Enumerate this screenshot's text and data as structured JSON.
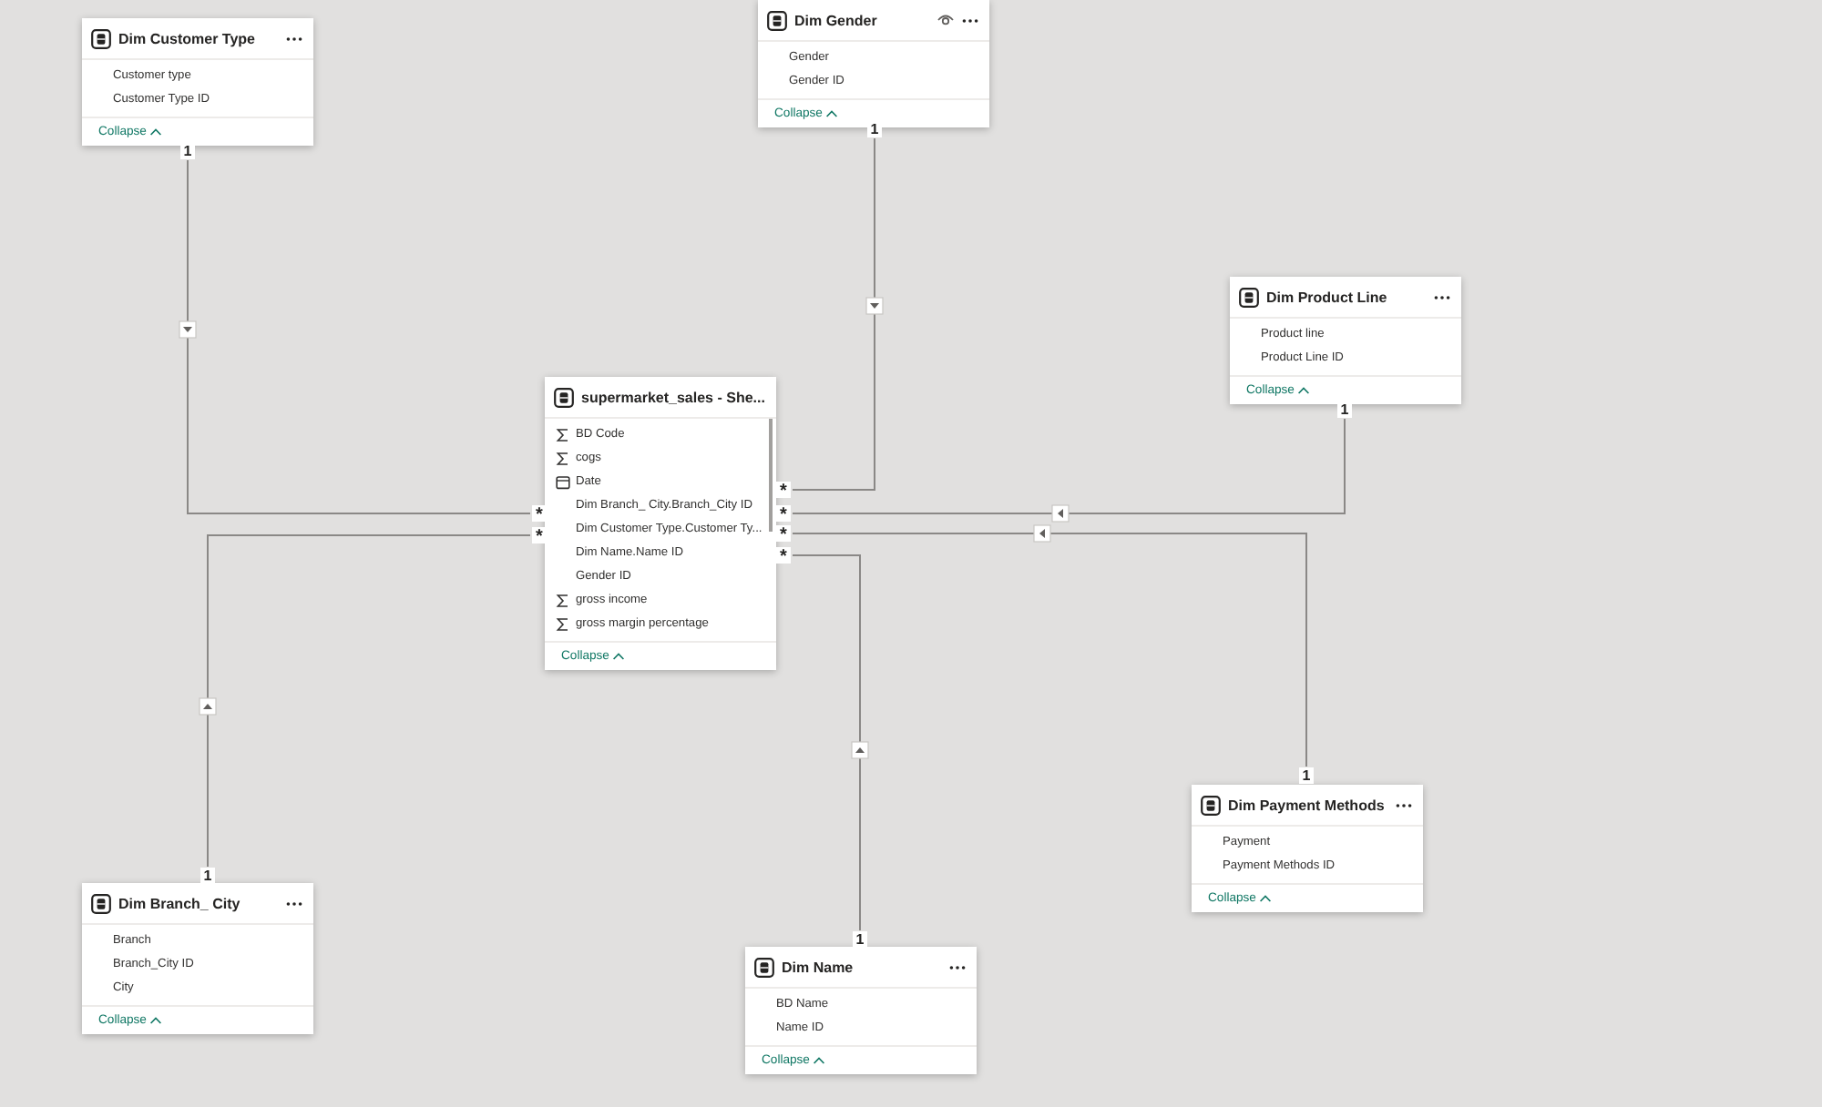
{
  "tables": [
    {
      "title": "Dim Customer Type",
      "hidden": false,
      "fields": [
        {
          "name": "Customer type",
          "kind": "column"
        },
        {
          "name": "Customer Type ID",
          "kind": "column"
        }
      ],
      "collapse": "Collapse"
    },
    {
      "title": "Dim Gender",
      "hidden": true,
      "fields": [
        {
          "name": "Gender",
          "kind": "column"
        },
        {
          "name": "Gender ID",
          "kind": "column"
        }
      ],
      "collapse": "Collapse"
    },
    {
      "title": "Dim Product Line",
      "hidden": false,
      "fields": [
        {
          "name": "Product line",
          "kind": "column"
        },
        {
          "name": "Product Line ID",
          "kind": "column"
        }
      ],
      "collapse": "Collapse"
    },
    {
      "title": "supermarket_sales - She...",
      "hidden": false,
      "fields": [
        {
          "name": "BD Code",
          "kind": "measure"
        },
        {
          "name": "cogs",
          "kind": "measure"
        },
        {
          "name": "Date",
          "kind": "date"
        },
        {
          "name": "Dim Branch_ City.Branch_City ID",
          "kind": "column"
        },
        {
          "name": "Dim Customer Type.Customer Ty...",
          "kind": "column"
        },
        {
          "name": "Dim Name.Name ID",
          "kind": "column"
        },
        {
          "name": "Gender ID",
          "kind": "column"
        },
        {
          "name": "gross income",
          "kind": "measure"
        },
        {
          "name": "gross margin percentage",
          "kind": "measure"
        }
      ],
      "collapse": "Collapse"
    },
    {
      "title": "Dim Payment Methods",
      "hidden": false,
      "fields": [
        {
          "name": "Payment",
          "kind": "column"
        },
        {
          "name": "Payment Methods ID",
          "kind": "column"
        }
      ],
      "collapse": "Collapse"
    },
    {
      "title": "Dim Branch_ City",
      "hidden": false,
      "fields": [
        {
          "name": "Branch",
          "kind": "column"
        },
        {
          "name": "Branch_City ID",
          "kind": "column"
        },
        {
          "name": "City",
          "kind": "column"
        }
      ],
      "collapse": "Collapse"
    },
    {
      "title": "Dim Name",
      "hidden": false,
      "fields": [
        {
          "name": "BD Name",
          "kind": "column"
        },
        {
          "name": "Name ID",
          "kind": "column"
        }
      ],
      "collapse": "Collapse"
    }
  ],
  "relationships": [
    {
      "one_label": "1",
      "many_label": "*"
    },
    {
      "one_label": "1",
      "many_label": "*"
    },
    {
      "one_label": "1",
      "many_label": "*"
    },
    {
      "one_label": "1",
      "many_label": "*"
    },
    {
      "one_label": "1",
      "many_label": "*"
    },
    {
      "one_label": "1",
      "many_label": "*"
    }
  ]
}
